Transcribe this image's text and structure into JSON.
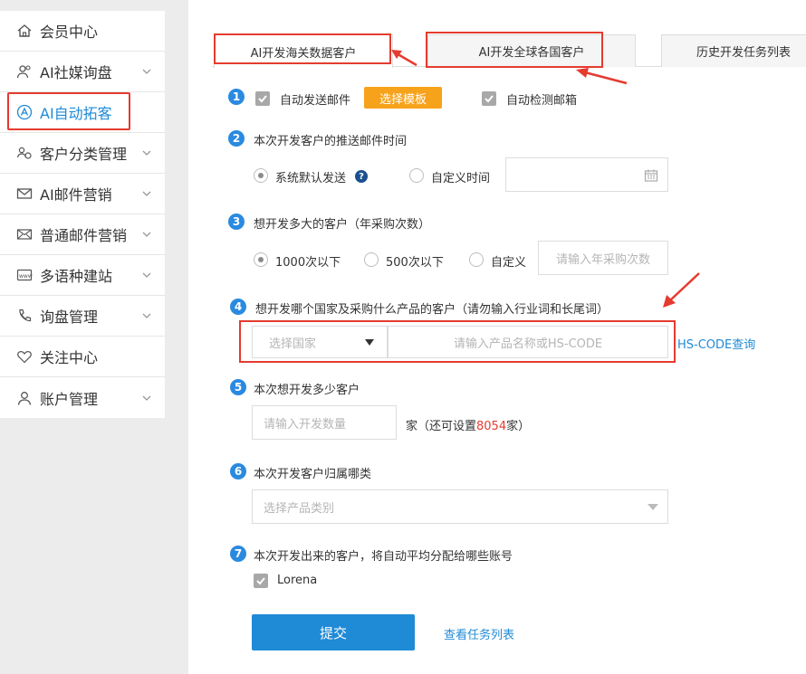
{
  "sidebar": {
    "items": [
      {
        "label": "会员中心",
        "icon": "home-icon",
        "chevron": false
      },
      {
        "label": "AI社媒询盘",
        "icon": "users-icon",
        "chevron": true
      },
      {
        "label": "AI自动拓客",
        "icon": "ai-prospect-icon",
        "chevron": false,
        "active": true
      },
      {
        "label": "客户分类管理",
        "icon": "customer-category-icon",
        "chevron": true
      },
      {
        "label": "AI邮件营销",
        "icon": "mail-icon",
        "chevron": true
      },
      {
        "label": "普通邮件营销",
        "icon": "mail-outline-icon",
        "chevron": true
      },
      {
        "label": "多语种建站",
        "icon": "website-icon",
        "chevron": true
      },
      {
        "label": "询盘管理",
        "icon": "phone-icon",
        "chevron": true
      },
      {
        "label": "关注中心",
        "icon": "heart-icon",
        "chevron": false
      },
      {
        "label": "账户管理",
        "icon": "user-icon",
        "chevron": true
      }
    ]
  },
  "tabs": [
    {
      "label": "AI开发海关数据客户",
      "active": true
    },
    {
      "label": "AI开发全球各国客户",
      "active": false
    },
    {
      "label": "历史开发任务列表",
      "active": false
    }
  ],
  "steps": {
    "s1": {
      "num": "1",
      "auto_email": "自动发送邮件",
      "choose_template": "选择模板",
      "auto_detect": "自动检测邮箱"
    },
    "s2": {
      "num": "2",
      "title": "本次开发客户的推送邮件时间",
      "opt_default": "系统默认发送",
      "help": "?",
      "opt_custom": "自定义时间"
    },
    "s3": {
      "num": "3",
      "title": "想开发多大的客户（年采购次数）",
      "opt1": "1000次以下",
      "opt2": "500次以下",
      "opt3": "自定义",
      "placeholder": "请输入年采购次数"
    },
    "s4": {
      "num": "4",
      "title": "想开发哪个国家及采购什么产品的客户（请勿输入行业词和长尾词）",
      "country_placeholder": "选择国家",
      "product_placeholder": "请输入产品名称或HS-CODE",
      "hs_link": "HS-CODE查询"
    },
    "s5": {
      "num": "5",
      "title": "本次想开发多少客户",
      "placeholder": "请输入开发数量",
      "suffix_a": "家（还可设置",
      "count": "8054",
      "suffix_b": "家）"
    },
    "s6": {
      "num": "6",
      "title": "本次开发客户归属哪类",
      "placeholder": "选择产品类别"
    },
    "s7": {
      "num": "7",
      "title": "本次开发出来的客户，将自动平均分配给哪些账号",
      "account": "Lorena"
    }
  },
  "actions": {
    "submit": "提交",
    "view_tasks": "查看任务列表"
  },
  "colors": {
    "accent": "#1f8ad6",
    "orange": "#f7a21b",
    "highlight_red": "#e53b2f",
    "step_blue": "#2a8ae0"
  }
}
